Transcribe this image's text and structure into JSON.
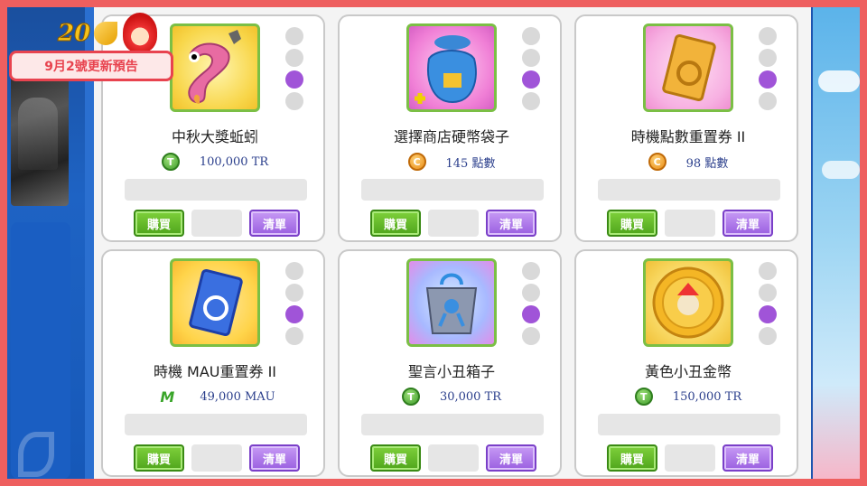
{
  "banner": {
    "text": "9月2號更新預告"
  },
  "buttons": {
    "buy": "購買",
    "list": "清單"
  },
  "items": [
    {
      "name": "中秋大獎蚯蚓",
      "currency_icon": "T",
      "price": "100,000 TR",
      "selected_dot": 3
    },
    {
      "name": "選擇商店硬幣袋子",
      "currency_icon": "C",
      "price": "145 點數",
      "selected_dot": 3
    },
    {
      "name": "時機點數重置券 II",
      "currency_icon": "C",
      "price": "98 點數",
      "selected_dot": 3
    },
    {
      "name": "時機 MAU重置券 II",
      "currency_icon": "M",
      "price": "49,000 MAU",
      "selected_dot": 3
    },
    {
      "name": "聖言小丑箱子",
      "currency_icon": "T",
      "price": "30,000 TR",
      "selected_dot": 3
    },
    {
      "name": "黃色小丑金幣",
      "currency_icon": "T",
      "price": "150,000 TR",
      "selected_dot": 3
    }
  ],
  "colors": {
    "frame": "#ee5f5f",
    "buy_button": "#5cb824",
    "list_button": "#a468e6",
    "selected_dot": "#a054d8"
  }
}
